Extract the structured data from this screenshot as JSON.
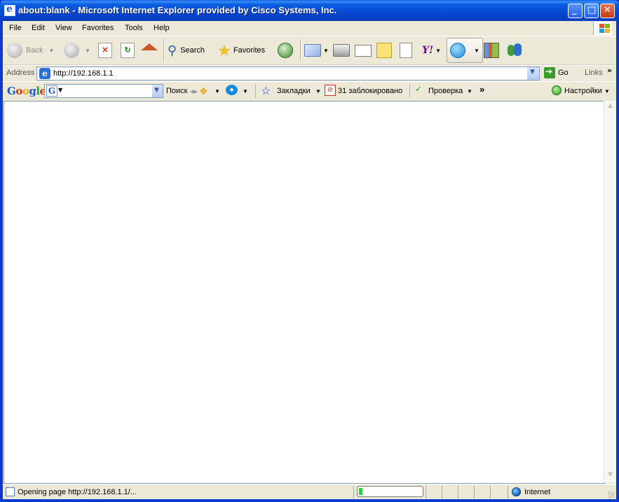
{
  "window": {
    "title": "about:blank - Microsoft Internet Explorer provided by Cisco Systems, Inc.",
    "minimize_glyph": "_",
    "maximize_glyph": "□",
    "close_glyph": "✕"
  },
  "menubar": {
    "items": [
      "File",
      "Edit",
      "View",
      "Favorites",
      "Tools",
      "Help"
    ]
  },
  "toolbar": {
    "back_label": "Back",
    "search_label": "Search",
    "favorites_label": "Favorites",
    "icons": [
      "back-icon",
      "forward-icon",
      "stop-icon",
      "refresh-icon",
      "home-icon",
      "search-icon",
      "favorites-star-icon",
      "history-icon",
      "mail-icon",
      "print-icon",
      "edit-icon",
      "discuss-icon",
      "messenger-icon",
      "yahoo-icon",
      "skype-icon",
      "research-icon",
      "msn-messenger-icon"
    ]
  },
  "addressbar": {
    "label": "Address",
    "url": "http://192.168.1.1",
    "go_label": "Go",
    "links_label": "Links",
    "chevron": "»"
  },
  "googlebar": {
    "logo": "Google",
    "search_label": "Поиск",
    "bookmarks_label": "Закладки",
    "blocked_label": "31 заблокировано",
    "check_label": "Проверка",
    "settings_label": "Настройки",
    "chevron": "»",
    "colors": {
      "g_blue": "#1a56d6",
      "g_red": "#d82b1d",
      "g_yellow": "#e8a80d",
      "g_green": "#2b9b2b"
    }
  },
  "statusbar": {
    "text": "Opening page http://192.168.1.1/...",
    "zone": "Internet",
    "progress": 0.06
  }
}
